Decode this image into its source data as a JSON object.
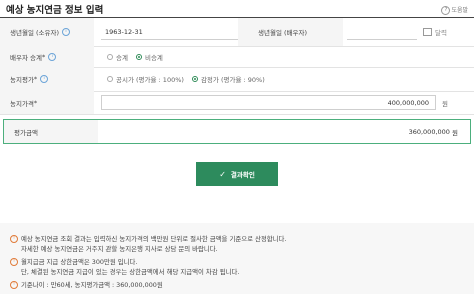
{
  "header": {
    "title": "예상 농지연금 정보 입력",
    "help_label": "도움말"
  },
  "rows": {
    "birth_owner": {
      "label": "생년월일 (소유자)",
      "value": "1963-12-31",
      "calendar_label": "달력"
    },
    "birth_spouse": {
      "label": "생년월일 (배우자)",
      "calendar_label": "달력"
    },
    "spouse_succession": {
      "label": "배우자 승계",
      "required": "*",
      "options": [
        "승계",
        "비승계"
      ],
      "selected": "비승계"
    },
    "land_valuation": {
      "label": "농지평가",
      "required": "*",
      "options": [
        "공시가 (평가율 : 100%)",
        "감정가 (평가율 : 90%)"
      ],
      "selected": "감정가 (평가율 : 90%)"
    },
    "land_price": {
      "label": "농지가격",
      "required": "*",
      "value": "400,000,000",
      "unit": "원"
    }
  },
  "result": {
    "label": "평가금액",
    "value": "360,000,000",
    "unit": "원"
  },
  "confirm_button": {
    "label": "결과확인"
  },
  "notes": {
    "n1_line1": "예상 농지연금 조회 결과는 입력하신 농지가격의 백만원 단위로 절사한 금액을 기준으로 산정합니다.",
    "n1_line2": "자세한 예상 농지연금은 거주지 관할 농지은행 지사로 상담 문의 바랍니다.",
    "n2_line1": "월지급금 지급 상한금액은 300만원 입니다.",
    "n2_line2": "단, 체결된 농지연금 지급이 있는 경우는 상한금액에서 해당 지급액이 차감 됩니다.",
    "n3_line1": "기준나이 : 만60세, 농지평가금액 : 360,000,000원"
  },
  "colors": {
    "accent": "#2d8b5d",
    "note_bullet": "#e07b39",
    "info": "#6ba4d8"
  }
}
